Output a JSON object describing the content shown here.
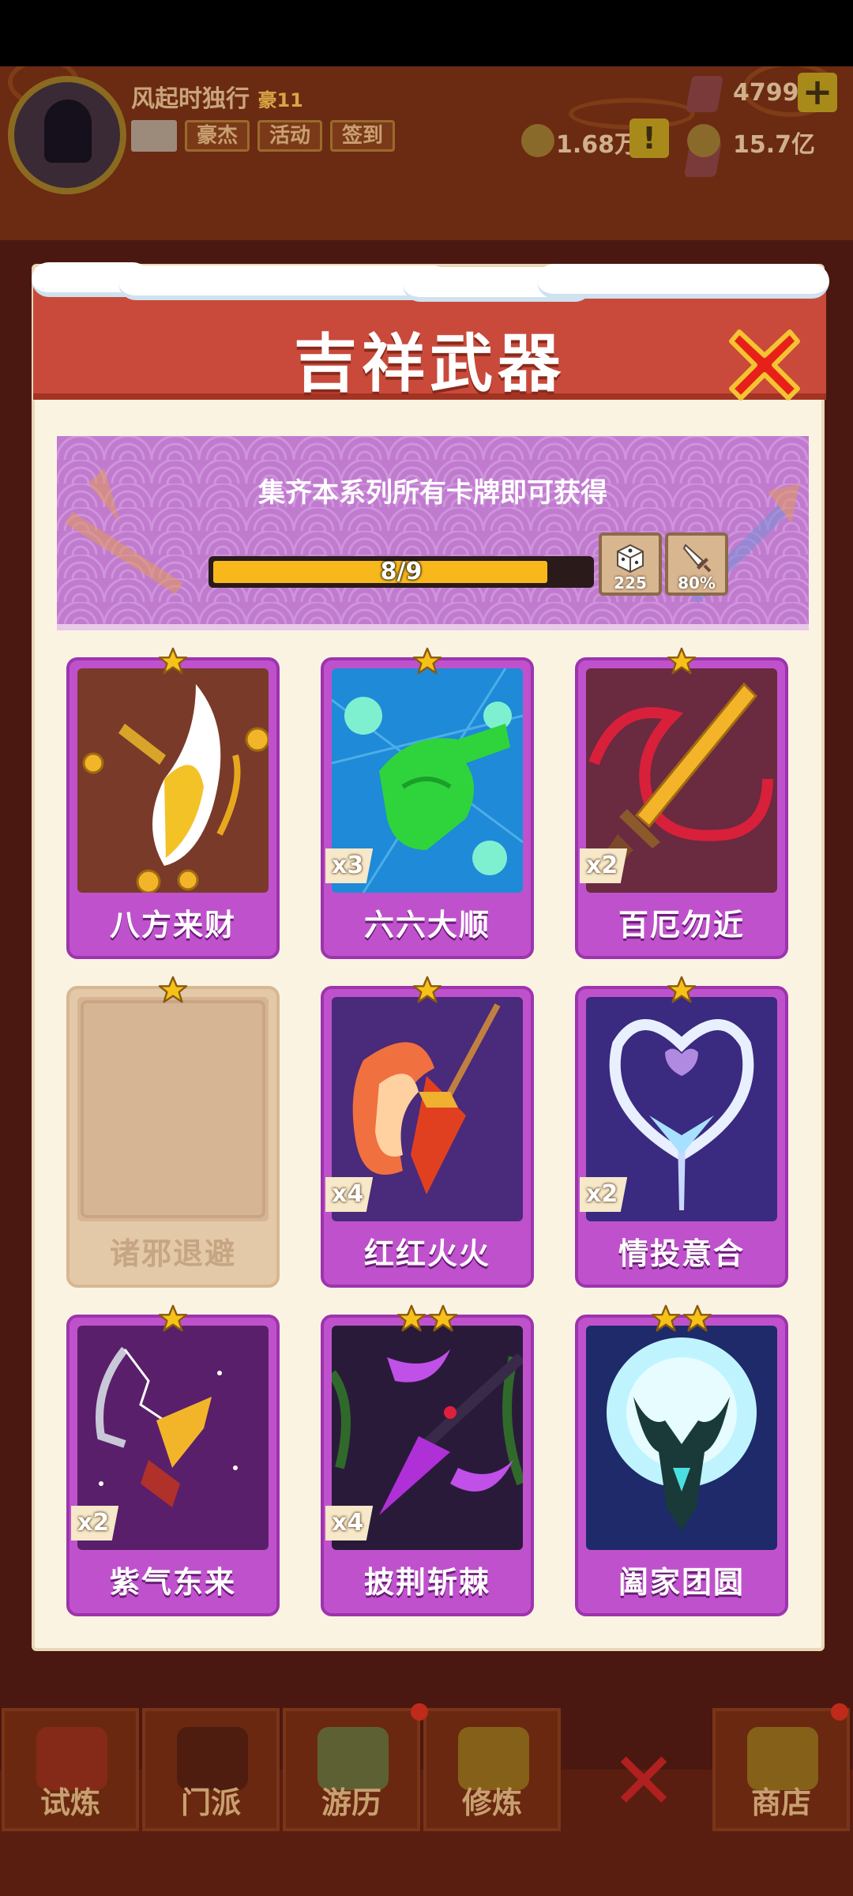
{
  "background": {
    "player": {
      "name": "风起时独行",
      "vip": "豪11"
    },
    "tags": [
      "豪杰",
      "活动",
      "签到"
    ],
    "gems": "4799",
    "power": "1.68万",
    "coins": "15.7亿",
    "tabs": [
      "试炼",
      "门派",
      "游历",
      "修炼",
      "商店"
    ]
  },
  "modal": {
    "title": "吉祥武器",
    "banner_text": "集齐本系列所有卡牌即可获得",
    "progress": {
      "current": 8,
      "total": 9,
      "label": "8/9"
    },
    "rewards": [
      {
        "icon": "dice-icon",
        "value": "225"
      },
      {
        "icon": "sword-icon",
        "value": "80%"
      }
    ]
  },
  "cards": [
    {
      "name": "八方来财",
      "count": "",
      "stars": 1,
      "owned": true,
      "icon": "golden-axe-coins"
    },
    {
      "name": "六六大顺",
      "count": "x3",
      "stars": 1,
      "owned": true,
      "icon": "green-hand-sign"
    },
    {
      "name": "百厄勿近",
      "count": "x2",
      "stars": 1,
      "owned": true,
      "icon": "golden-sword-ribbon"
    },
    {
      "name": "诸邪退避",
      "count": "",
      "stars": 1,
      "owned": false,
      "icon": "locked-card"
    },
    {
      "name": "红红火火",
      "count": "x4",
      "stars": 1,
      "owned": true,
      "icon": "fire-glaive"
    },
    {
      "name": "情投意合",
      "count": "x2",
      "stars": 1,
      "owned": true,
      "icon": "heart-staff"
    },
    {
      "name": "紫气东来",
      "count": "x2",
      "stars": 1,
      "owned": true,
      "icon": "lightning-bow"
    },
    {
      "name": "披荆斩棘",
      "count": "x4",
      "stars": 2,
      "owned": true,
      "icon": "purple-spear"
    },
    {
      "name": "阖家团圆",
      "count": "",
      "stars": 2,
      "owned": true,
      "icon": "moon-antler-staff"
    }
  ],
  "colors": {
    "header": "#c94a3b",
    "card_frame": "#bf52cc",
    "progress_fill": "#f8b81c",
    "close_x": "#e8201a"
  }
}
